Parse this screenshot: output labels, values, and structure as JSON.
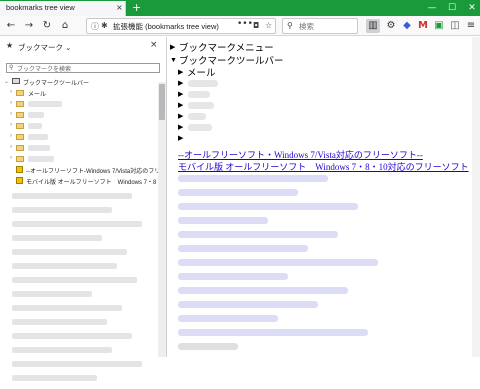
{
  "window": {
    "tab_title": "bookmarks tree view",
    "tab_close": "×",
    "new_tab": "+",
    "minimize": "—",
    "maximize": "☐",
    "close": "✕"
  },
  "toolbar": {
    "back": "←",
    "forward": "→",
    "reload": "↻",
    "home": "⌂",
    "url_prefix": "拡張機能",
    "url_text": "(bookmarks tree view)",
    "url_dots": "•••",
    "search_placeholder": "検索"
  },
  "sidebar": {
    "title": "ブックマーク",
    "close": "×",
    "search_placeholder": "ブックマークを検索",
    "tree": [
      {
        "label": "ブックマークツールバー",
        "type": "root"
      },
      {
        "label": "メール",
        "type": "folder"
      },
      {
        "label": "",
        "type": "folder"
      },
      {
        "label": "",
        "type": "folder"
      },
      {
        "label": "",
        "type": "folder"
      },
      {
        "label": "",
        "type": "folder"
      },
      {
        "label": "",
        "type": "folder"
      },
      {
        "label": "",
        "type": "folder"
      },
      {
        "label": "--オールフリーソフト-Windows 7/Vista対応のフリーソ...",
        "type": "bookmark"
      },
      {
        "label": "モバイル版 オールフリーソフト　Windows 7・8・10対応...",
        "type": "bookmark"
      }
    ]
  },
  "content": {
    "items": [
      {
        "label": "ブックマークメニュー"
      },
      {
        "label": "ブックマークツールバー"
      },
      {
        "label": "メール"
      }
    ],
    "links": [
      "--オールフリーソフト・Windows 7/Vista対応のフリーソフト--",
      "モバイル版 オールフリーソフト　Windows 7・8・10対応のフリーソフト"
    ]
  },
  "colors": {
    "titlebar": "#1a9a3a",
    "link": "#2000d0"
  }
}
